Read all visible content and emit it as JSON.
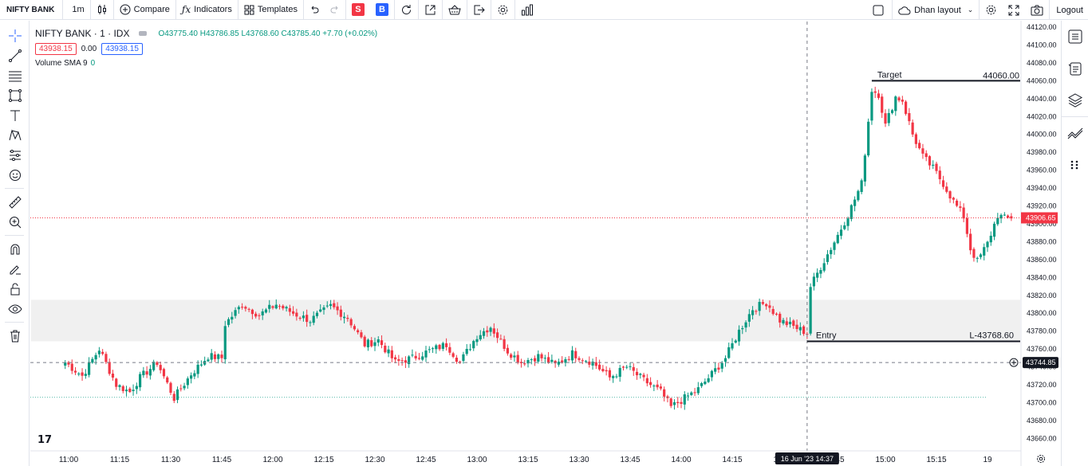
{
  "toolbar": {
    "symbol": "NIFTY BANK",
    "interval": "1m",
    "compare": "Compare",
    "indicators": "Indicators",
    "templates": "Templates",
    "sell": "S",
    "buy": "B",
    "layout": "Dhan layout",
    "logout": "Logout"
  },
  "legend": {
    "title": "NIFTY BANK · 1 · IDX",
    "ohlc": "O43775.40 H43786.85 L43768.60 C43785.40 +7.70 (+0.02%)",
    "sell_price": "43938.15",
    "spread": "0.00",
    "buy_price": "43938.15",
    "volume_label": "Volume SMA 9",
    "volume_value": "0"
  },
  "colors": {
    "up": "#089981",
    "down": "#f23645",
    "zone": "#f0f0f0"
  },
  "chart_data": {
    "type": "candlestick",
    "y_ticks": [
      "44120.00",
      "44100.00",
      "44080.00",
      "44060.00",
      "44040.00",
      "44020.00",
      "44000.00",
      "43980.00",
      "43960.00",
      "43940.00",
      "43920.00",
      "43900.00",
      "43880.00",
      "43860.00",
      "43840.00",
      "43820.00",
      "43800.00",
      "43780.00",
      "43760.00",
      "43740.00",
      "43720.00",
      "43700.00",
      "43680.00",
      "43660.00"
    ],
    "ylim": [
      43650,
      44125
    ],
    "x_ticks": [
      "11:00",
      "11:15",
      "11:30",
      "11:45",
      "12:00",
      "12:15",
      "12:30",
      "12:45",
      "13:00",
      "13:15",
      "13:30",
      "13:45",
      "14:00",
      "14:15",
      "14:30",
      "14:45",
      "15:00",
      "15:15",
      "19"
    ],
    "x_tick_values": [
      1,
      16,
      31,
      46,
      61,
      76,
      91,
      106,
      121,
      136,
      151,
      166,
      181,
      196,
      211,
      226,
      241,
      256,
      271
    ],
    "price_labels": {
      "last_price": "43906.65",
      "crosshair_price": "43744.85",
      "crosshair_time": "16 Jun '23   14:37"
    },
    "annotations": {
      "target_label": "Target",
      "target_value": "44060.00",
      "entry_label": "Entry",
      "entry_value": "L-43768.60"
    },
    "levels": {
      "target": 44060,
      "entry": 43768.6,
      "last": 43906.65,
      "crosshair": 43744.85,
      "zone_top": 43815,
      "zone_bottom": 43768.6,
      "lower_dotted": 43706
    },
    "crosshair_x": 218,
    "anchors": [
      [
        0,
        43745
      ],
      [
        5,
        43730
      ],
      [
        10,
        43760
      ],
      [
        15,
        43720
      ],
      [
        19,
        43712
      ],
      [
        22,
        43728
      ],
      [
        27,
        43745
      ],
      [
        32,
        43705
      ],
      [
        37,
        43732
      ],
      [
        42,
        43752
      ],
      [
        46,
        43750
      ],
      [
        47,
        43788
      ],
      [
        52,
        43810
      ],
      [
        57,
        43798
      ],
      [
        62,
        43810
      ],
      [
        67,
        43800
      ],
      [
        72,
        43792
      ],
      [
        78,
        43808
      ],
      [
        83,
        43795
      ],
      [
        88,
        43765
      ],
      [
        92,
        43770
      ],
      [
        97,
        43745
      ],
      [
        102,
        43750
      ],
      [
        107,
        43758
      ],
      [
        112,
        43765
      ],
      [
        116,
        43745
      ],
      [
        121,
        43775
      ],
      [
        125,
        43785
      ],
      [
        130,
        43758
      ],
      [
        134,
        43745
      ],
      [
        139,
        43752
      ],
      [
        144,
        43742
      ],
      [
        149,
        43755
      ],
      [
        155,
        43745
      ],
      [
        160,
        43728
      ],
      [
        165,
        43740
      ],
      [
        170,
        43725
      ],
      [
        175,
        43712
      ],
      [
        178,
        43695
      ],
      [
        182,
        43705
      ],
      [
        186,
        43715
      ],
      [
        190,
        43732
      ],
      [
        194,
        43750
      ],
      [
        198,
        43780
      ],
      [
        202,
        43805
      ],
      [
        206,
        43812
      ],
      [
        210,
        43792
      ],
      [
        214,
        43785
      ],
      [
        218,
        43778
      ],
      [
        219,
        43830
      ],
      [
        222,
        43852
      ],
      [
        226,
        43880
      ],
      [
        230,
        43910
      ],
      [
        234,
        43945
      ],
      [
        237,
        44050
      ],
      [
        239,
        44045
      ],
      [
        241,
        44010
      ],
      [
        244,
        44042
      ],
      [
        246,
        44038
      ],
      [
        249,
        44000
      ],
      [
        252,
        43975
      ],
      [
        255,
        43962
      ],
      [
        258,
        43945
      ],
      [
        261,
        43925
      ],
      [
        264,
        43908
      ],
      [
        266,
        43872
      ],
      [
        268,
        43858
      ],
      [
        271,
        43878
      ],
      [
        274,
        43910
      ],
      [
        276,
        43906
      ],
      [
        278,
        43906
      ]
    ]
  }
}
